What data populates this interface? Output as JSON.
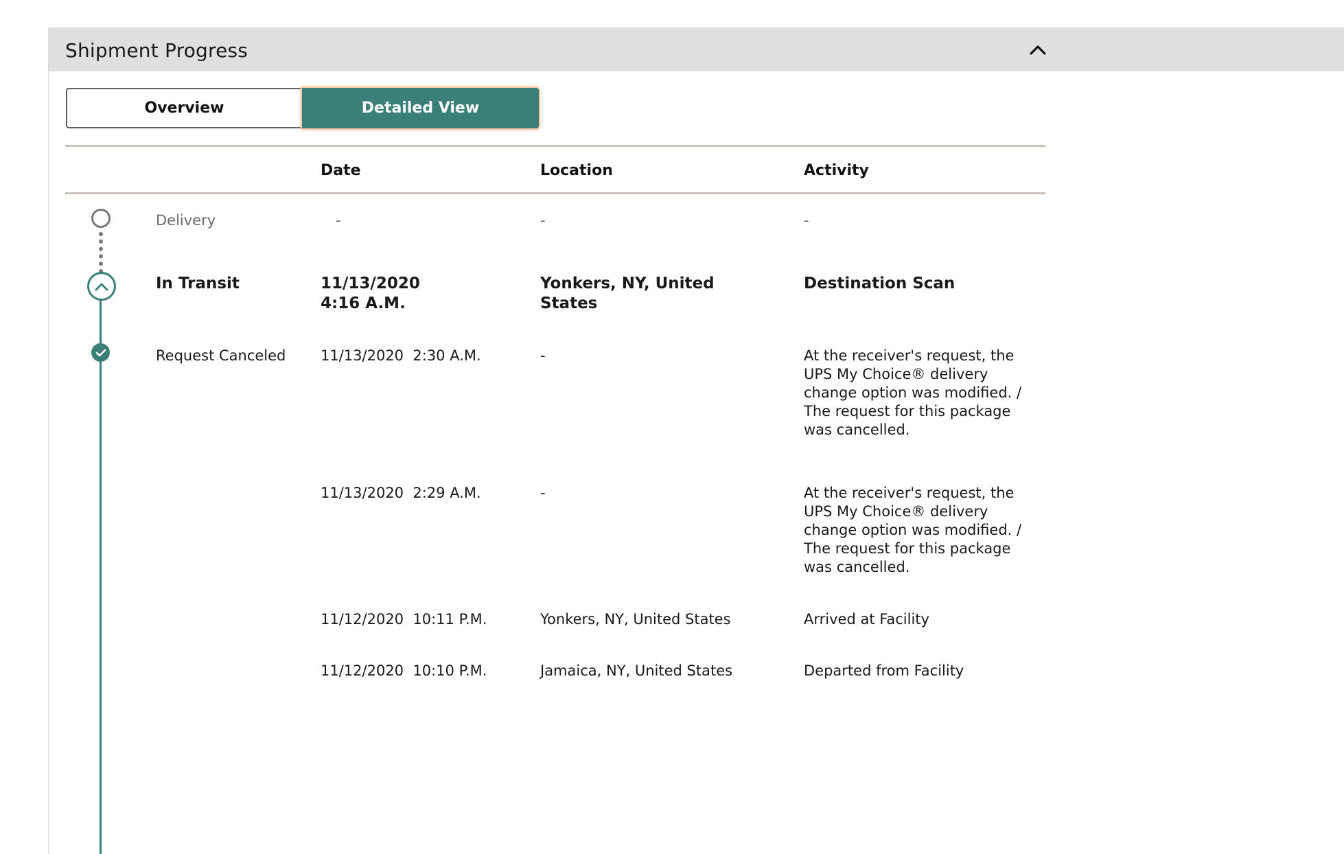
{
  "panel": {
    "title": "Shipment Progress",
    "collapse_icon": "chevron-up-icon"
  },
  "toggle": {
    "overview_label": "Overview",
    "detailed_label": "Detailed View",
    "active": "Detailed View"
  },
  "table": {
    "headers": {
      "date": "Date",
      "location": "Location",
      "activity": "Activity"
    },
    "milestones": [
      {
        "status": "Delivery",
        "date": "-",
        "location": "-",
        "activity": "-"
      },
      {
        "status": "In Transit",
        "date_line1": "11/13/2020",
        "date_line2": "4:16 A.M.",
        "location_line1": "Yonkers, NY, United",
        "location_line2": "States",
        "activity": "Destination Scan"
      },
      {
        "status": "Request Canceled"
      }
    ],
    "events": [
      {
        "date": "11/13/2020  2:30 A.M.",
        "location": "-",
        "activity_lines": [
          "At the receiver's request, the",
          "UPS My Choice® delivery",
          "change option was modified. /",
          "The request for this package",
          "was cancelled."
        ]
      },
      {
        "date": "11/13/2020  2:29 A.M.",
        "location": "-",
        "activity_lines": [
          "At the receiver's request, the",
          "UPS My Choice® delivery",
          "change option was modified. /",
          "The request for this package",
          "was cancelled."
        ]
      },
      {
        "date": "11/12/2020  10:11 P.M.",
        "location": "Yonkers, NY, United States",
        "activity_lines": [
          "Arrived at Facility"
        ]
      },
      {
        "date": "11/12/2020  10:10 P.M.",
        "location": "Jamaica, NY, United States",
        "activity_lines": [
          "Departed from Facility"
        ]
      }
    ]
  },
  "colors": {
    "accent": "#3a8079",
    "header_bg": "#dfdfdf",
    "muted_text": "#6b6b6b",
    "rule": "#c9c3bb"
  }
}
